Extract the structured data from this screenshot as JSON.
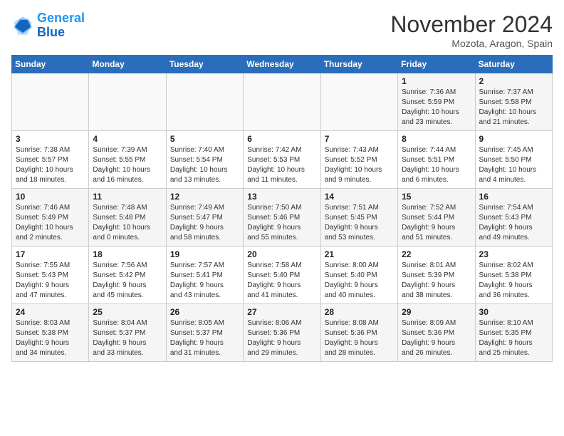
{
  "logo": {
    "line1": "General",
    "line2": "Blue"
  },
  "title": "November 2024",
  "location": "Mozota, Aragon, Spain",
  "days_of_week": [
    "Sunday",
    "Monday",
    "Tuesday",
    "Wednesday",
    "Thursday",
    "Friday",
    "Saturday"
  ],
  "weeks": [
    [
      {
        "day": "",
        "info": ""
      },
      {
        "day": "",
        "info": ""
      },
      {
        "day": "",
        "info": ""
      },
      {
        "day": "",
        "info": ""
      },
      {
        "day": "",
        "info": ""
      },
      {
        "day": "1",
        "info": "Sunrise: 7:36 AM\nSunset: 5:59 PM\nDaylight: 10 hours\nand 23 minutes."
      },
      {
        "day": "2",
        "info": "Sunrise: 7:37 AM\nSunset: 5:58 PM\nDaylight: 10 hours\nand 21 minutes."
      }
    ],
    [
      {
        "day": "3",
        "info": "Sunrise: 7:38 AM\nSunset: 5:57 PM\nDaylight: 10 hours\nand 18 minutes."
      },
      {
        "day": "4",
        "info": "Sunrise: 7:39 AM\nSunset: 5:55 PM\nDaylight: 10 hours\nand 16 minutes."
      },
      {
        "day": "5",
        "info": "Sunrise: 7:40 AM\nSunset: 5:54 PM\nDaylight: 10 hours\nand 13 minutes."
      },
      {
        "day": "6",
        "info": "Sunrise: 7:42 AM\nSunset: 5:53 PM\nDaylight: 10 hours\nand 11 minutes."
      },
      {
        "day": "7",
        "info": "Sunrise: 7:43 AM\nSunset: 5:52 PM\nDaylight: 10 hours\nand 9 minutes."
      },
      {
        "day": "8",
        "info": "Sunrise: 7:44 AM\nSunset: 5:51 PM\nDaylight: 10 hours\nand 6 minutes."
      },
      {
        "day": "9",
        "info": "Sunrise: 7:45 AM\nSunset: 5:50 PM\nDaylight: 10 hours\nand 4 minutes."
      }
    ],
    [
      {
        "day": "10",
        "info": "Sunrise: 7:46 AM\nSunset: 5:49 PM\nDaylight: 10 hours\nand 2 minutes."
      },
      {
        "day": "11",
        "info": "Sunrise: 7:48 AM\nSunset: 5:48 PM\nDaylight: 10 hours\nand 0 minutes."
      },
      {
        "day": "12",
        "info": "Sunrise: 7:49 AM\nSunset: 5:47 PM\nDaylight: 9 hours\nand 58 minutes."
      },
      {
        "day": "13",
        "info": "Sunrise: 7:50 AM\nSunset: 5:46 PM\nDaylight: 9 hours\nand 55 minutes."
      },
      {
        "day": "14",
        "info": "Sunrise: 7:51 AM\nSunset: 5:45 PM\nDaylight: 9 hours\nand 53 minutes."
      },
      {
        "day": "15",
        "info": "Sunrise: 7:52 AM\nSunset: 5:44 PM\nDaylight: 9 hours\nand 51 minutes."
      },
      {
        "day": "16",
        "info": "Sunrise: 7:54 AM\nSunset: 5:43 PM\nDaylight: 9 hours\nand 49 minutes."
      }
    ],
    [
      {
        "day": "17",
        "info": "Sunrise: 7:55 AM\nSunset: 5:43 PM\nDaylight: 9 hours\nand 47 minutes."
      },
      {
        "day": "18",
        "info": "Sunrise: 7:56 AM\nSunset: 5:42 PM\nDaylight: 9 hours\nand 45 minutes."
      },
      {
        "day": "19",
        "info": "Sunrise: 7:57 AM\nSunset: 5:41 PM\nDaylight: 9 hours\nand 43 minutes."
      },
      {
        "day": "20",
        "info": "Sunrise: 7:58 AM\nSunset: 5:40 PM\nDaylight: 9 hours\nand 41 minutes."
      },
      {
        "day": "21",
        "info": "Sunrise: 8:00 AM\nSunset: 5:40 PM\nDaylight: 9 hours\nand 40 minutes."
      },
      {
        "day": "22",
        "info": "Sunrise: 8:01 AM\nSunset: 5:39 PM\nDaylight: 9 hours\nand 38 minutes."
      },
      {
        "day": "23",
        "info": "Sunrise: 8:02 AM\nSunset: 5:38 PM\nDaylight: 9 hours\nand 36 minutes."
      }
    ],
    [
      {
        "day": "24",
        "info": "Sunrise: 8:03 AM\nSunset: 5:38 PM\nDaylight: 9 hours\nand 34 minutes."
      },
      {
        "day": "25",
        "info": "Sunrise: 8:04 AM\nSunset: 5:37 PM\nDaylight: 9 hours\nand 33 minutes."
      },
      {
        "day": "26",
        "info": "Sunrise: 8:05 AM\nSunset: 5:37 PM\nDaylight: 9 hours\nand 31 minutes."
      },
      {
        "day": "27",
        "info": "Sunrise: 8:06 AM\nSunset: 5:36 PM\nDaylight: 9 hours\nand 29 minutes."
      },
      {
        "day": "28",
        "info": "Sunrise: 8:08 AM\nSunset: 5:36 PM\nDaylight: 9 hours\nand 28 minutes."
      },
      {
        "day": "29",
        "info": "Sunrise: 8:09 AM\nSunset: 5:36 PM\nDaylight: 9 hours\nand 26 minutes."
      },
      {
        "day": "30",
        "info": "Sunrise: 8:10 AM\nSunset: 5:35 PM\nDaylight: 9 hours\nand 25 minutes."
      }
    ]
  ]
}
